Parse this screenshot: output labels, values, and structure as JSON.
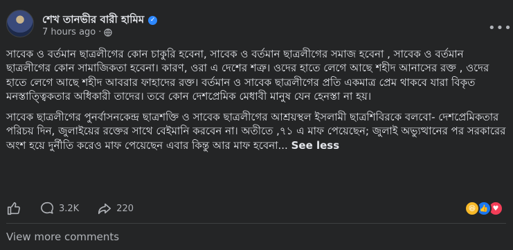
{
  "post": {
    "author": "শেখ তানভীর বারী হামিম",
    "time": "7 hours ago",
    "verified": true,
    "paragraphs": [
      "সাবেক ও বর্তমান ছাত্রলীগের কোন চাকুরি হবেনা, সাবেক ও বর্তমান ছাত্রলীগের সমাজ হবেনা , সাবেক ও বর্তমান ছাত্রলীগের কোন সামাজিকতা হবেনা। কারণ, ওরা এ দেশের শত্রু। ওদের হাতে লেগে আছে শহীদ আনাসের রক্ত , ওদের হাতে লেগে আছে শহীদ আবরার ফাহাদের রক্ত। বর্তমান ও সাবেক ছাত্রলীগের প্রতি একমাত্র প্রেম থাকবে যারা বিকৃত মনস্তাত্ত্বিকতার অধিকারী তাদের। তবে কোন দেশপ্রেমিক মেধাবী মানুষ যেন হেনস্তা না হয়।",
      "সাবেক ছাত্রলীগের পুনর্বাসনকেন্দ্র ছাত্রশক্তি ও সাবেক ছাত্রলীগের আশ্রয়স্থল ইসলামী ছাত্রশিবিরকে বলবো- দেশপ্রেমিকতার পরিচয় দিন, জুলাইয়ের রক্তের সাথে বেইমানি করবেন না। অতীতে ,৭১ এ মাফ পেয়েছেন; জুলাই অভ্যুত্থানের পর সরকারের অংশ হয়ে দুর্নীতি করেও মাফ পেয়েছেন এবার কিন্তু আর মাফ হবেনা..."
    ],
    "see_less": "See less"
  },
  "actions": {
    "comments_count": "3.2K",
    "shares_count": "220"
  },
  "reactions": [
    "haha-icon",
    "like-icon",
    "love-icon"
  ],
  "footer": {
    "view_more": "View more comments"
  },
  "colors": {
    "background": "#242526",
    "text": "#e4e6eb",
    "muted": "#b0b3b8",
    "accent": "#2d88ff"
  }
}
